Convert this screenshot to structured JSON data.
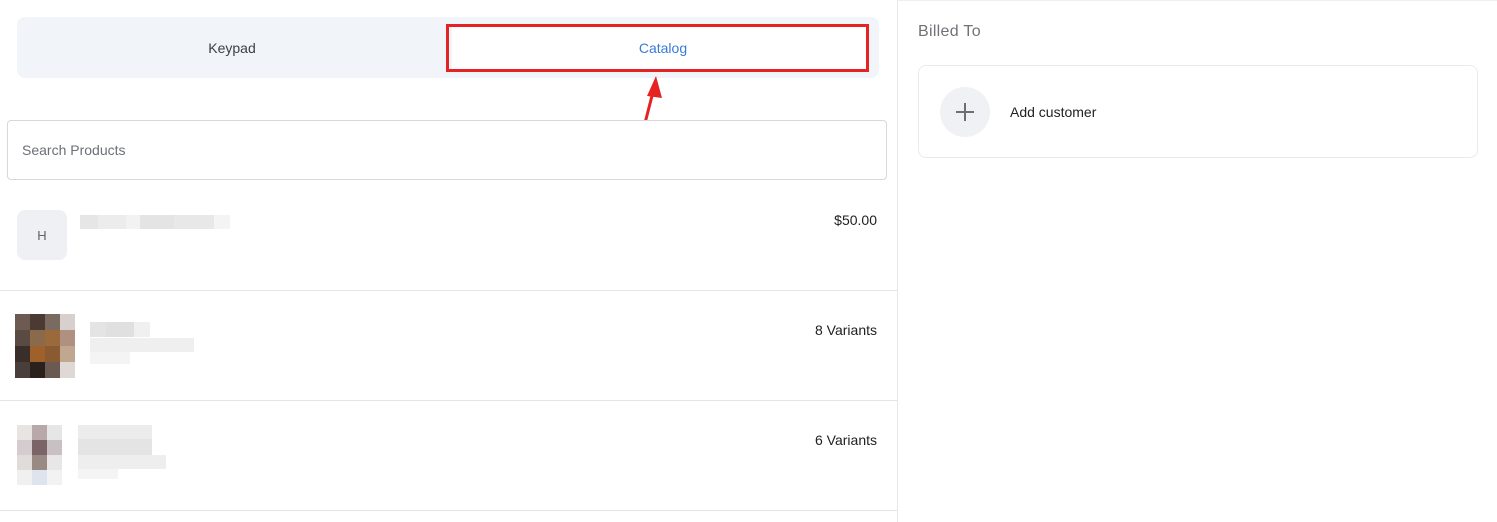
{
  "tabs": {
    "keypad_label": "Keypad",
    "catalog_label": "Catalog",
    "selected": "Catalog"
  },
  "search": {
    "placeholder": "Search Products",
    "value": ""
  },
  "products": [
    {
      "avatar_letter": "H",
      "right_text": "$50.00"
    },
    {
      "right_text": "8 Variants"
    },
    {
      "right_text": "6 Variants"
    }
  ],
  "billing": {
    "heading": "Billed To",
    "add_customer_label": "Add customer",
    "add_icon": "plus-icon"
  },
  "colors": {
    "accent": "#3a7bd5",
    "annotation": "#e52323"
  }
}
